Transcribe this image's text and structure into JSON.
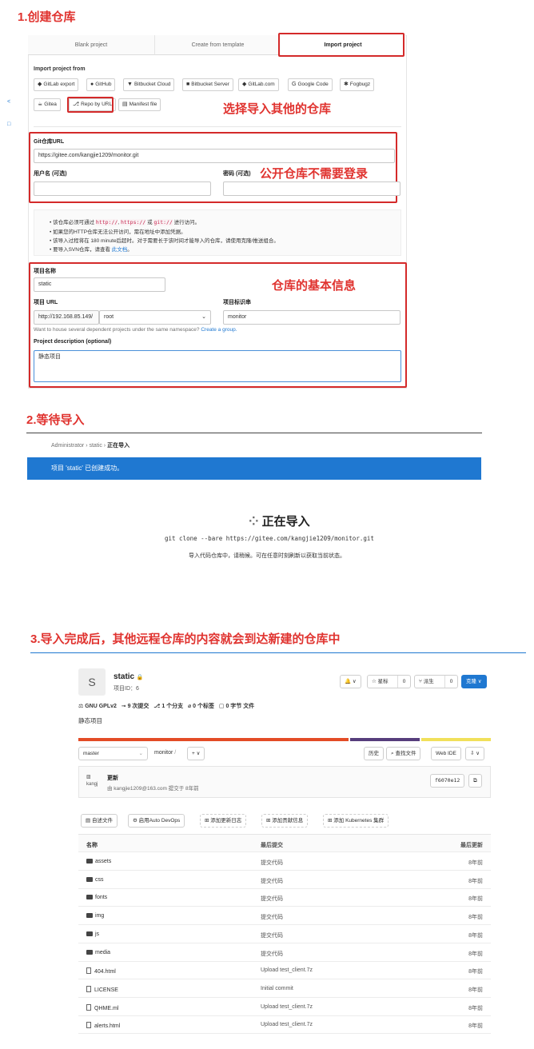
{
  "step1": {
    "title": "1.创建仓库",
    "tabs": [
      "Blank project",
      "Create from template",
      "Import project"
    ],
    "import_from_label": "Import project from",
    "sources_row1": [
      "GitLab export",
      "GitHub",
      "Bitbucket Cloud",
      "Bitbucket Server",
      "GitLab.com",
      "Google Code",
      "Fogbugz"
    ],
    "sources_row2": [
      "Gitea",
      "Repo by URL",
      "Manifest file"
    ],
    "note_select": "选择导入其他的仓库",
    "git_url_label": "Git仓库URL",
    "git_url_value": "https://gitee.com/kangjie1209/monitor.git",
    "username_label": "用户名 (可选)",
    "password_label": "密码 (可选)",
    "note_public": "公开仓库不需要登录",
    "tips": {
      "t1_a": "该仓库必须可通过",
      "t1_c1": "http://",
      "t1_c2": "https://",
      "t1_b": "或",
      "t1_c3": "git://",
      "t1_d": "进行访问。",
      "t2": "如果您的HTTP仓库无法公开访问，需在地址中添加凭据。",
      "t3": "该导入过程将在 180 minute后超时。对于需要长于该时间才能导入的仓库，请使用克隆/推送组合。",
      "t4_a": "要导入SVN仓库，请查看",
      "t4_link": "此文档",
      "t4_b": "。"
    },
    "project_name_label": "项目名称",
    "project_name_value": "static",
    "project_url_label": "项目 URL",
    "project_url_prefix": "http://192.168.85.149/",
    "namespace_value": "root",
    "slug_label": "项目标识串",
    "slug_value": "monitor",
    "namespace_hint": "Want to house several dependent projects under the same namespace?",
    "namespace_hint_link": "Create a group.",
    "description_label": "Project description (optional)",
    "description_value": "静态项目",
    "note_basic": "仓库的基本信息",
    "side_marks": [
      "<",
      "□"
    ]
  },
  "step2": {
    "title": "2.等待导入",
    "breadcrumb": [
      "Administrator",
      "static",
      "正在导入"
    ],
    "breadcrumb_sep": "›",
    "flash": "项目 'static' 已创建成功。",
    "importing_title": "正在导入",
    "clone_cmd": "git clone --bare https://gitee.com/kangjie1209/monitor.git",
    "importing_desc": "导入代码仓库中，请稍候。可在任意时刻刷新以获取当前状态。"
  },
  "step3": {
    "title": "3.导入完成后，其他远程仓库的内容就会到达新建的仓库中",
    "avatar_letter": "S",
    "project_name": "static",
    "project_id": "项目ID：6",
    "bell": "🔔 ∨",
    "star_label": "☆ 星标",
    "star_count": "0",
    "fork_label": "⑂ 派生",
    "fork_count": "0",
    "clone_button": "克隆 ∨",
    "stats": [
      "GNU GPLv2",
      "9 次提交",
      "1 个分支",
      "0 个标签",
      "0 字节 文件"
    ],
    "description": "静态项目",
    "language_colors": [
      "#e34c26",
      "#563d7c",
      "#f1e05a"
    ],
    "language_shares": [
      0.66,
      0.17,
      0.17
    ],
    "branch": "master",
    "path": "monitor",
    "path_sep": "/",
    "add_button": "+ ∨",
    "history_button": "历史",
    "find_file_button": "查找文件",
    "web_ide_button": "Web IDE",
    "download_button": "⇩ ∨",
    "commit_avatar_text": "kangj",
    "commit_title": "更新",
    "commit_meta": "由 kangjie1209@163.com 提交于 8年前",
    "commit_sha": "f6070e12",
    "copy_icon": "⧉",
    "action_buttons": [
      "自述文件",
      "启用Auto DevOps",
      "添加更新日志",
      "添加贡献信息",
      "添加 Kubernetes 集群"
    ],
    "table_headers": [
      "名称",
      "最后提交",
      "最后更新"
    ],
    "rows": [
      {
        "name": "assets",
        "type": "folder",
        "commit": "提交代码",
        "time": "8年前"
      },
      {
        "name": "css",
        "type": "folder",
        "commit": "提交代码",
        "time": "8年前"
      },
      {
        "name": "fonts",
        "type": "folder",
        "commit": "提交代码",
        "time": "8年前"
      },
      {
        "name": "img",
        "type": "folder",
        "commit": "提交代码",
        "time": "8年前"
      },
      {
        "name": "js",
        "type": "folder",
        "commit": "提交代码",
        "time": "8年前"
      },
      {
        "name": "media",
        "type": "folder",
        "commit": "提交代码",
        "time": "8年前"
      },
      {
        "name": "404.html",
        "type": "file",
        "commit": "Upload test_client.7z",
        "time": "8年前"
      },
      {
        "name": "LICENSE",
        "type": "file",
        "commit": "Initial commit",
        "time": "8年前"
      },
      {
        "name": "QHME.ml",
        "type": "file",
        "commit": "Upload test_client.7z",
        "time": "8年前"
      },
      {
        "name": "alerts.html",
        "type": "file",
        "commit": "Upload test_client.7z",
        "time": "8年前"
      }
    ]
  }
}
